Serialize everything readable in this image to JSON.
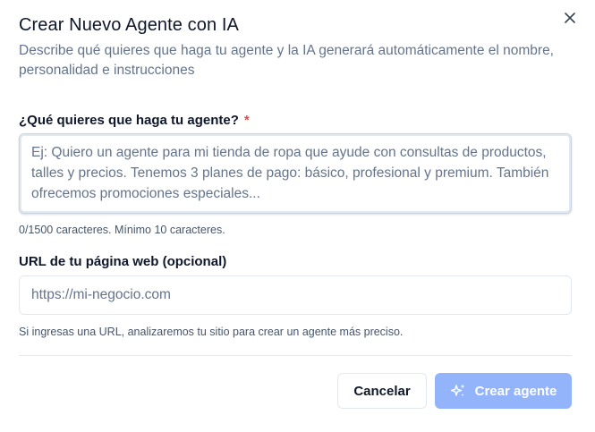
{
  "dialog": {
    "title": "Crear Nuevo Agente con IA",
    "subtitle": "Describe qué quieres que haga tu agente y la IA generará automáticamente el nombre, personalidad e instrucciones"
  },
  "description_field": {
    "label": "¿Qué quieres que haga tu agente?",
    "required_mark": "*",
    "value": "",
    "placeholder": "Ej: Quiero un agente para mi tienda de ropa que ayude con consultas de productos, talles y precios. Tenemos 3 planes de pago: básico, profesional y premium. También ofrecemos promociones especiales...",
    "helper": "0/1500 caracteres. Mínimo 10 caracteres."
  },
  "url_field": {
    "label": "URL de tu página web (opcional)",
    "value": "",
    "placeholder": "https://mi-negocio.com",
    "helper": "Si ingresas una URL, analizaremos tu sitio para crear un agente más preciso."
  },
  "actions": {
    "cancel_label": "Cancelar",
    "create_label": "Crear agente",
    "create_icon": "sparkles-icon"
  },
  "icons": {
    "close": "close-icon"
  },
  "colors": {
    "primary_disabled": "#93b4fb",
    "required": "#ef4444",
    "muted_text": "#64748b"
  }
}
